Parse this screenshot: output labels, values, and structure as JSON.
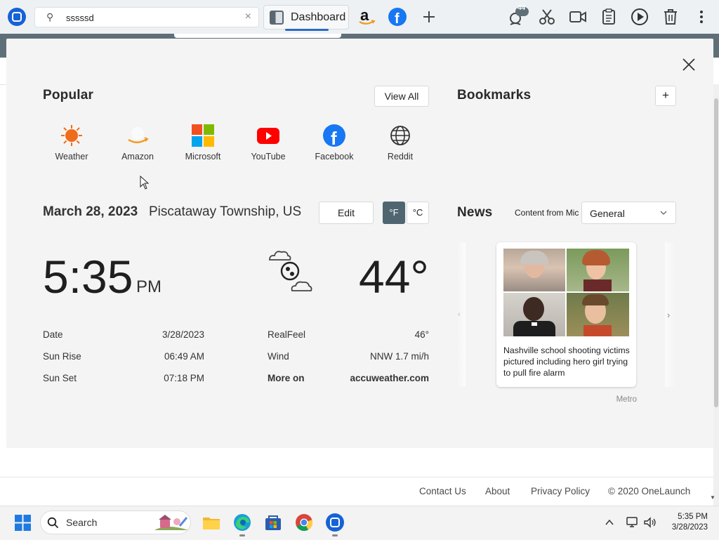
{
  "browser": {
    "search_value": "sssssd",
    "active_tab": "Dashboard",
    "notification_count": "44"
  },
  "popular": {
    "title": "Popular",
    "view_all": "View All",
    "apps": [
      {
        "label": "Weather"
      },
      {
        "label": "Amazon"
      },
      {
        "label": "Microsoft"
      },
      {
        "label": "YouTube"
      },
      {
        "label": "Facebook"
      },
      {
        "label": "Reddit"
      }
    ]
  },
  "bookmarks": {
    "title": "Bookmarks",
    "add": "+"
  },
  "weather": {
    "date": "March 28, 2023",
    "location": "Piscataway Township, US",
    "edit": "Edit",
    "unit_f": "°F",
    "unit_c": "°C",
    "time": "5:35",
    "ampm": "PM",
    "temperature": "44°",
    "rows_left": [
      {
        "label": "Date",
        "value": "3/28/2023"
      },
      {
        "label": "Sun Rise",
        "value": "06:49 AM"
      },
      {
        "label": "Sun Set",
        "value": "07:18 PM"
      }
    ],
    "rows_right": [
      {
        "label": "RealFeel",
        "value": "46°"
      },
      {
        "label": "Wind",
        "value": "NNW 1.7 mi/h"
      },
      {
        "label": "More on",
        "value": "accuweather.com"
      }
    ]
  },
  "news": {
    "title": "News",
    "content_from": "Content from Mic",
    "category": "General",
    "headline": "Nashville school shooting victims pictured including hero girl trying to pull fire alarm",
    "source": "Metro"
  },
  "footer": {
    "links": [
      "Contact Us",
      "About",
      "Privacy Policy"
    ],
    "copyright": "© 2020 OneLaunch"
  },
  "taskbar": {
    "search_label": "Search",
    "time": "5:35 PM",
    "date": "3/28/2023"
  },
  "colors": {
    "accent": "#2b6cc4",
    "frame": "#5f6f78",
    "unit_active": "#4f6670"
  }
}
